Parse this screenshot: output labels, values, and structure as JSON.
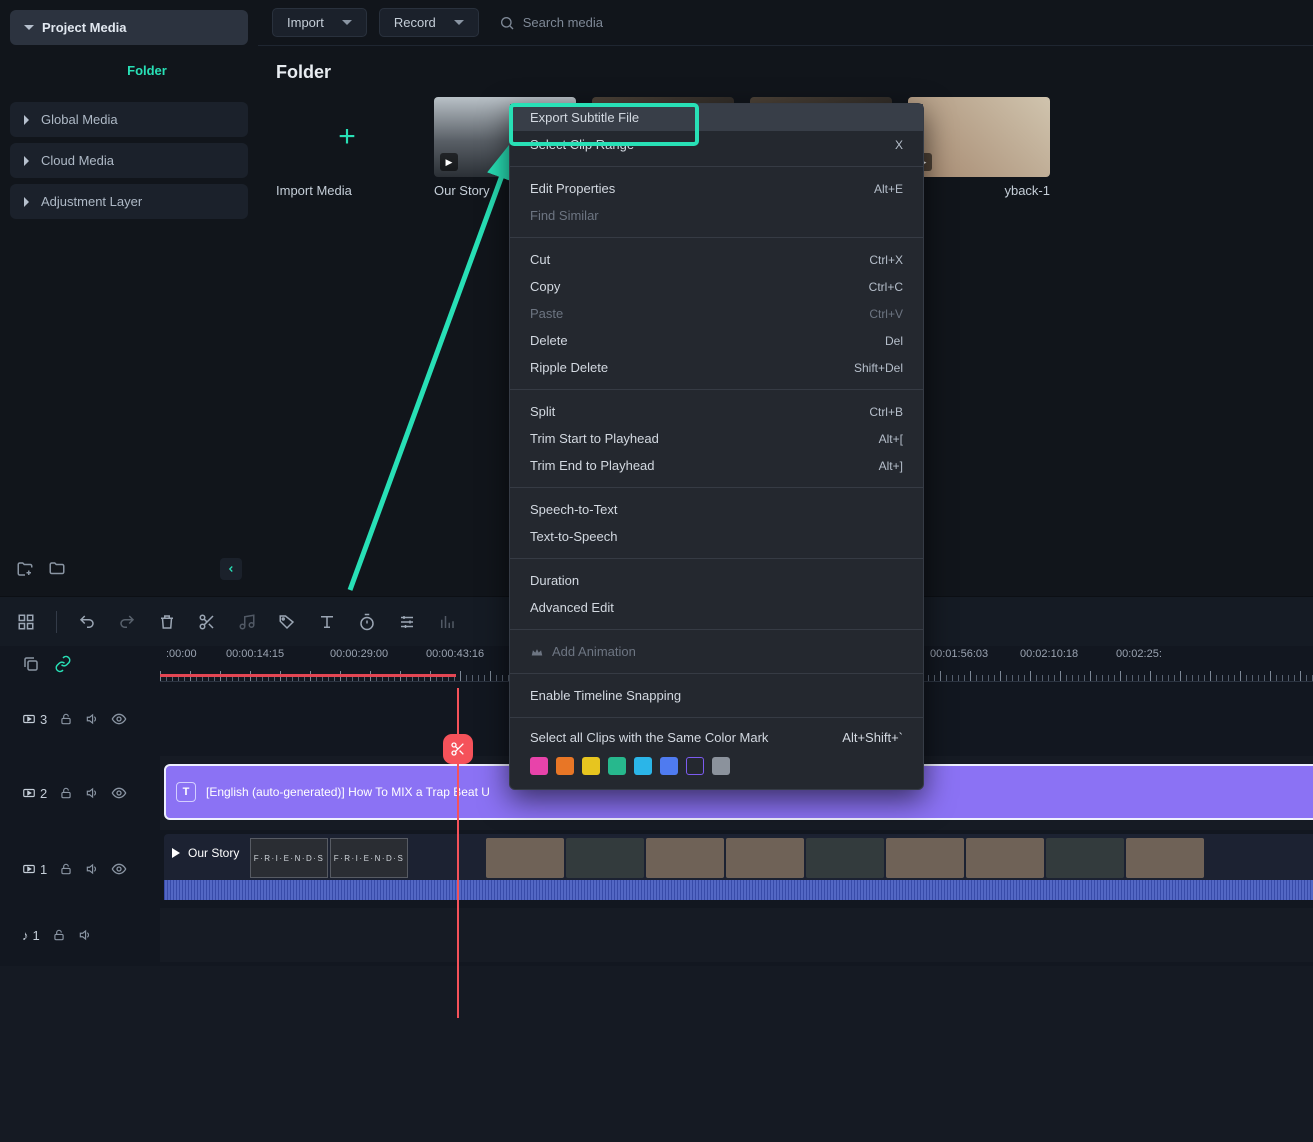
{
  "sidebar": {
    "header": "Project Media",
    "folder": "Folder",
    "items": [
      "Global Media",
      "Cloud Media",
      "Adjustment Layer"
    ]
  },
  "topbar": {
    "import": "Import",
    "record": "Record",
    "search_placeholder": "Search media"
  },
  "media": {
    "section": "Folder",
    "import_label": "Import Media",
    "items": [
      "Our Story",
      "",
      "yback-1"
    ]
  },
  "context_menu": {
    "export_subtitle": "Export Subtitle File",
    "select_clip": {
      "label": "Select Clip Range",
      "sc": "X"
    },
    "edit_props": {
      "label": "Edit Properties",
      "sc": "Alt+E"
    },
    "find_similar": "Find Similar",
    "cut": {
      "label": "Cut",
      "sc": "Ctrl+X"
    },
    "copy": {
      "label": "Copy",
      "sc": "Ctrl+C"
    },
    "paste": {
      "label": "Paste",
      "sc": "Ctrl+V"
    },
    "delete": {
      "label": "Delete",
      "sc": "Del"
    },
    "ripple_delete": {
      "label": "Ripple Delete",
      "sc": "Shift+Del"
    },
    "split": {
      "label": "Split",
      "sc": "Ctrl+B"
    },
    "trim_start": {
      "label": "Trim Start to Playhead",
      "sc": "Alt+["
    },
    "trim_end": {
      "label": "Trim End to Playhead",
      "sc": "Alt+]"
    },
    "stt": "Speech-to-Text",
    "tts": "Text-to-Speech",
    "duration": "Duration",
    "advanced": "Advanced Edit",
    "add_anim": "Add Animation",
    "snap": "Enable Timeline Snapping",
    "color_mark": {
      "label": "Select all Clips with the Same Color Mark",
      "sc": "Alt+Shift+`"
    },
    "colors": [
      "#e843aa",
      "#e87626",
      "#e7c51f",
      "#27b88d",
      "#2bb5e8",
      "#4f7bf0",
      "#7c5bf0",
      "#8b929c"
    ]
  },
  "ruler": {
    "labels": [
      ":00:00",
      "00:00:14:15",
      "00:00:29:00",
      "00:00:43:16",
      "00:01:56:03",
      "00:02:10:18",
      "00:02:25:"
    ]
  },
  "tracks": {
    "t3": "3",
    "t2": "2",
    "t1": "1",
    "a1": "1",
    "subtitle_text": "[English (auto-generated)] How To MIX a Trap Beat U",
    "video_label": "Our Story"
  }
}
